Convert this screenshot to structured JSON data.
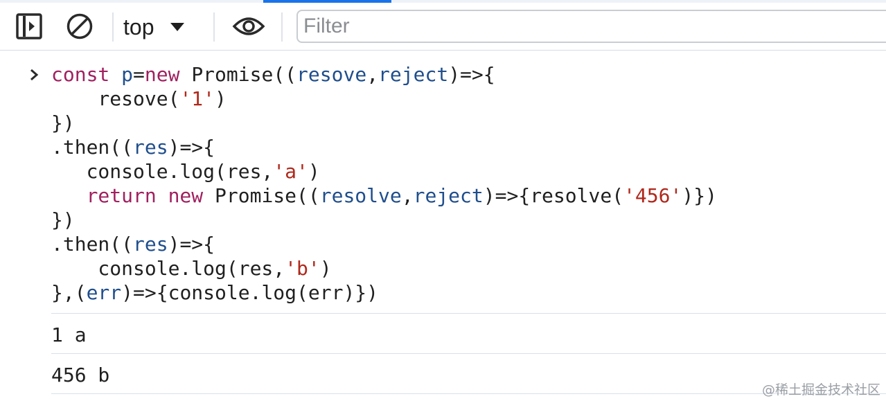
{
  "toolbar": {
    "sidebar_toggle_icon": "sidebar-toggle-icon",
    "clear_icon": "clear-console-icon",
    "context": "top",
    "live_expression_icon": "eye-icon",
    "filter_placeholder": "Filter"
  },
  "console": {
    "input_code": [
      [
        [
          "kw",
          "const "
        ],
        [
          "vr",
          "p"
        ],
        [
          "pn",
          "="
        ],
        [
          "kw",
          "new "
        ],
        [
          "pn",
          "Promise(("
        ],
        [
          "vr",
          "resove"
        ],
        [
          "pn",
          ","
        ],
        [
          "vr",
          "reject"
        ],
        [
          "pn",
          ")=>{"
        ]
      ],
      [
        [
          "pn",
          "    resove("
        ],
        [
          "st",
          "'1'"
        ],
        [
          "pn",
          ")"
        ]
      ],
      [
        [
          "pn",
          "})"
        ]
      ],
      [
        [
          "pn",
          ".then(("
        ],
        [
          "vr",
          "res"
        ],
        [
          "pn",
          ")=>{"
        ]
      ],
      [
        [
          "pn",
          "   console.log(res,"
        ],
        [
          "st",
          "'a'"
        ],
        [
          "pn",
          ")"
        ]
      ],
      [
        [
          "kw",
          "   return new "
        ],
        [
          "pn",
          "Promise(("
        ],
        [
          "vr",
          "resolve"
        ],
        [
          "pn",
          ","
        ],
        [
          "vr",
          "reject"
        ],
        [
          "pn",
          ")=>{resolve("
        ],
        [
          "st",
          "'456'"
        ],
        [
          "pn",
          ")})"
        ]
      ],
      [
        [
          "pn",
          "})"
        ]
      ],
      [
        [
          "pn",
          ".then(("
        ],
        [
          "vr",
          "res"
        ],
        [
          "pn",
          ")=>{"
        ]
      ],
      [
        [
          "pn",
          "    console.log(res,"
        ],
        [
          "st",
          "'b'"
        ],
        [
          "pn",
          ")"
        ]
      ],
      [
        [
          "pn",
          "},("
        ],
        [
          "vr",
          "err"
        ],
        [
          "pn",
          ")=>{console.log(err)})"
        ]
      ]
    ],
    "outputs": [
      "1 a",
      "456 b"
    ]
  },
  "watermark": "@稀土掘金技术社区"
}
